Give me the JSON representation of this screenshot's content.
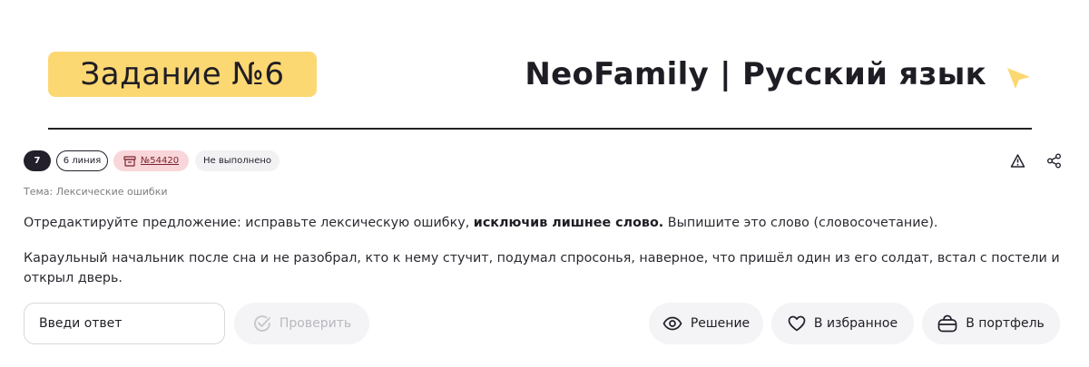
{
  "header": {
    "task_label": "Задание №6",
    "brand": "NeoFamily | Русский язык",
    "accent_color": "#fcd873"
  },
  "meta": {
    "number_badge": "7",
    "line_badge": "6 линия",
    "task_id": "№54420",
    "status": "Не выполнено",
    "topic": "Тема: Лексические ошибки"
  },
  "task": {
    "instruction_start": "Отредактируйте предложение: исправьте лексическую ошибку,",
    "instruction_bold": "исключив лишнее слово.",
    "instruction_end": "Выпишите это слово (словосочетание).",
    "sentence": "Караульный начальник после сна и не разобрал, кто к нему стучит, подумал спросонья, наверное, что пришёл один из его солдат, встал с постели и открыл дверь."
  },
  "controls": {
    "answer_placeholder": "Введи ответ",
    "check_label": "Проверить",
    "solution_label": "Решение",
    "favorite_label": "В избранное",
    "portfolio_label": "В портфель"
  },
  "icons": {
    "brand_arrow": "cursor-arrow-icon",
    "report": "warning-icon",
    "share": "share-icon",
    "task_id": "archive-box-icon",
    "check": "check-circle-icon",
    "solution": "eye-icon",
    "favorite": "heart-icon",
    "portfolio": "briefcase-icon"
  }
}
